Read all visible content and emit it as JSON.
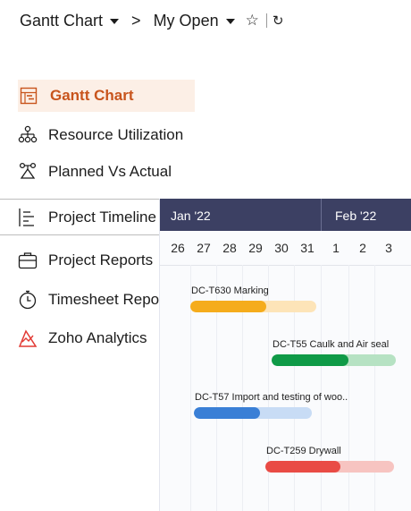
{
  "breadcrumb": {
    "view": "Gantt Chart",
    "filter": "My Open",
    "separator": ">",
    "star": "☆",
    "refresh": "↻"
  },
  "menu": {
    "items": [
      {
        "label": "Gantt Chart",
        "icon": "gantt-chart-icon",
        "active": true
      },
      {
        "label": "Resource Utilization",
        "icon": "resource-tree-icon",
        "active": false
      },
      {
        "label": "Planned Vs Actual",
        "icon": "scale-icon",
        "active": false
      },
      {
        "label": "Project Timeline G",
        "icon": "timeline-icon",
        "active": false
      },
      {
        "label": "Project Reports",
        "icon": "briefcase-icon",
        "active": false
      },
      {
        "label": "Timesheet Report",
        "icon": "stopwatch-icon",
        "active": false
      },
      {
        "label": "Zoho Analytics",
        "icon": "analytics-icon",
        "active": false
      }
    ],
    "active_color": "#c8541c",
    "active_bg": "#fcefe6"
  },
  "gantt": {
    "months": [
      "Jan '22",
      "Feb '22"
    ],
    "days": [
      "26",
      "27",
      "28",
      "29",
      "30",
      "31",
      "1",
      "2",
      "3"
    ],
    "header_color": "#3c4063",
    "tasks": [
      {
        "label": "DC-T630 Marking",
        "progress": 0.6,
        "color": "#f5ac1c",
        "track": "#fde4b8"
      },
      {
        "label": "DC-T55 Caulk and Air seal",
        "progress": 0.62,
        "color": "#0f9a47",
        "track": "#b6e2c3"
      },
      {
        "label": "DC-T57 Import and testing of woo..",
        "progress": 0.56,
        "color": "#3a7fd6",
        "track": "#c8dcf5"
      },
      {
        "label": "DC-T259 Drywall",
        "progress": 0.58,
        "color": "#e94b45",
        "track": "#f7c4c1"
      }
    ]
  }
}
